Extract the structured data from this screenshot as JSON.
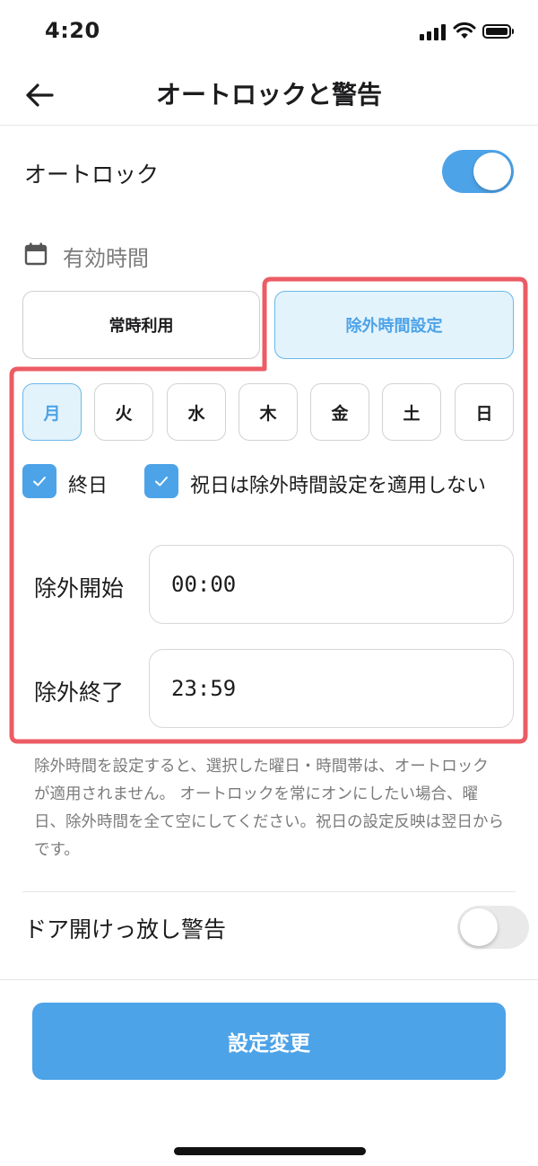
{
  "status_bar": {
    "time": "4:20"
  },
  "header": {
    "title": "オートロックと警告"
  },
  "auto_lock": {
    "label": "オートロック",
    "enabled": true
  },
  "valid_time": {
    "section_label": "有効時間",
    "modes": [
      {
        "label": "常時利用",
        "selected": false
      },
      {
        "label": "除外時間設定",
        "selected": true
      }
    ]
  },
  "days": [
    {
      "label": "月",
      "selected": true
    },
    {
      "label": "火",
      "selected": false
    },
    {
      "label": "水",
      "selected": false
    },
    {
      "label": "木",
      "selected": false
    },
    {
      "label": "金",
      "selected": false
    },
    {
      "label": "土",
      "selected": false
    },
    {
      "label": "日",
      "selected": false
    }
  ],
  "checkboxes": {
    "all_day": {
      "label": "終日",
      "checked": true
    },
    "holiday": {
      "label": "祝日は除外時間設定を適用しない",
      "checked": true
    }
  },
  "exclude_start": {
    "label": "除外開始",
    "value": "00:00"
  },
  "exclude_end": {
    "label": "除外終了",
    "value": "23:59"
  },
  "note": "除外時間を設定すると、選択した曜日・時間帯は、オートロックが適用されません。 オートロックを常にオンにしたい場合、曜日、除外時間を全て空にしてください。祝日の設定反映は翌日からです。",
  "door_alert": {
    "label": "ドア開けっ放し警告",
    "enabled": false
  },
  "submit_label": "設定変更",
  "colors": {
    "accent": "#4da3e8",
    "highlight_frame": "#ec5c64"
  }
}
